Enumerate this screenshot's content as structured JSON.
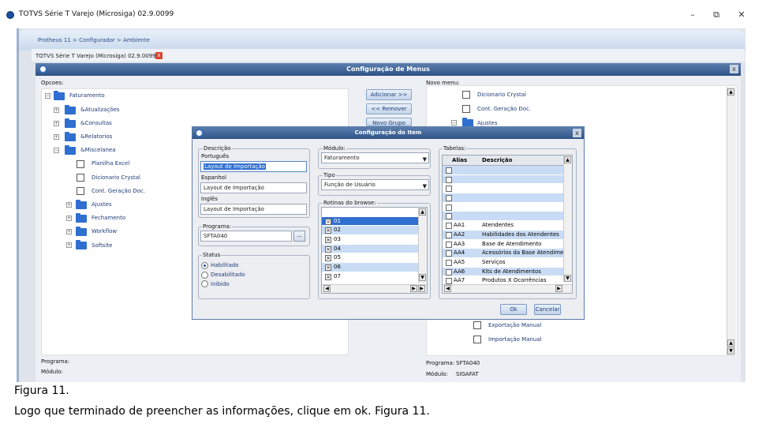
{
  "window": {
    "title": "TOTVS Série T Varejo (Microsiga) 02.9.0099",
    "minimize": "–",
    "maximize": "⧉",
    "close": "✕"
  },
  "breadcrumb": "Protheus 11 > Configurador > Ambiente",
  "tab": {
    "label": "TOTVS Série T Varejo (Microsiga) 02.9.0099",
    "close": "x"
  },
  "menu_window": {
    "title": "Configuração de Menus",
    "close": "x",
    "left_label": "Opcoes:",
    "right_label": "Novo menu:",
    "left_tree": [
      {
        "label": "Faturamento",
        "type": "folder",
        "level": 0,
        "toggle": "−"
      },
      {
        "label": "&Atualizações",
        "type": "folder",
        "level": 1,
        "toggle": "+"
      },
      {
        "label": "&Consultas",
        "type": "folder",
        "level": 1,
        "toggle": "+"
      },
      {
        "label": "&Relatorios",
        "type": "folder",
        "level": 1,
        "toggle": "+"
      },
      {
        "label": "&Miscelanea",
        "type": "folder",
        "level": 1,
        "toggle": "−"
      },
      {
        "label": "Planilha Excel",
        "type": "page",
        "level": 2
      },
      {
        "label": "Dicionario Crystal",
        "type": "page",
        "level": 2
      },
      {
        "label": "Cont. Geração Doc.",
        "type": "page",
        "level": 2
      },
      {
        "label": "Ajustes",
        "type": "folder",
        "level": 2,
        "toggle": "+"
      },
      {
        "label": "Fechamento",
        "type": "folder",
        "level": 2,
        "toggle": "+"
      },
      {
        "label": "Workflow",
        "type": "folder",
        "level": 2,
        "toggle": "+"
      },
      {
        "label": "Softsite",
        "type": "folder",
        "level": 2,
        "toggle": "+"
      }
    ],
    "right_tree_top": [
      {
        "label": "Dicionario Crystal",
        "type": "page"
      },
      {
        "label": "Cont. Geração Doc.",
        "type": "page"
      },
      {
        "label": "Ajustes",
        "type": "folder",
        "toggle": "−"
      }
    ],
    "right_tree_bottom": [
      {
        "label": "Exportação Manual",
        "type": "page"
      },
      {
        "label": "Importação Manual",
        "type": "page"
      }
    ],
    "buttons": {
      "add": "Adicionar >>",
      "remove": "<< Remover",
      "new_group": "Novo Grupo"
    },
    "footer_left": {
      "programa_label": "Programa:",
      "modulo_label": "Módulo:"
    },
    "footer_right": {
      "programa_label": "Programa:",
      "programa_value": "SFTA040",
      "modulo_label": "Módulo:",
      "modulo_value": "SIGAFAT"
    }
  },
  "item_dialog": {
    "title": "Configuração do Item",
    "close": "x",
    "descricao": {
      "group_label": "Descrição",
      "pt_label": "Português",
      "pt_value": "Layout de Importação",
      "es_label": "Espanhol",
      "es_value": "Layout de Importação",
      "en_label": "Inglês",
      "en_value": "Layout de Importação"
    },
    "programa": {
      "label": "Programa:",
      "value": "SFTA040",
      "browse": "..."
    },
    "status": {
      "label": "Status",
      "options": [
        "Habilitado",
        "Desabilitado",
        "Inibido"
      ],
      "selected": "Habilitado"
    },
    "modulo": {
      "label": "Módulo:",
      "value": "Faturamento"
    },
    "tipo": {
      "label": "Tipo",
      "value": "Função de Usuário"
    },
    "rotinas": {
      "label": "Rotinas do browse:",
      "items": [
        "01",
        "02",
        "03",
        "04",
        "05",
        "06",
        "07"
      ]
    },
    "tabelas": {
      "label": "Tabelas:",
      "columns": [
        "Alias",
        "Descrição"
      ],
      "rows": [
        {
          "alias": "",
          "desc": ""
        },
        {
          "alias": "",
          "desc": ""
        },
        {
          "alias": "",
          "desc": ""
        },
        {
          "alias": "",
          "desc": ""
        },
        {
          "alias": "",
          "desc": ""
        },
        {
          "alias": "",
          "desc": ""
        },
        {
          "alias": "AA1",
          "desc": "Atendentes"
        },
        {
          "alias": "AA2",
          "desc": "Habilidades dos Atendentes"
        },
        {
          "alias": "AA3",
          "desc": "Base de Atendimento"
        },
        {
          "alias": "AA4",
          "desc": "Acessórios da Base Atendimer"
        },
        {
          "alias": "AA5",
          "desc": "Serviços"
        },
        {
          "alias": "AA6",
          "desc": "Kits de Atendimentos"
        },
        {
          "alias": "AA7",
          "desc": "Produtos X Ocorrências"
        }
      ]
    },
    "ok": "Ok",
    "cancel": "Cancelar"
  },
  "caption": {
    "line1": "Figura 11.",
    "line2": "Logo que terminado de preencher as informações, clique em ok. Figura 11."
  }
}
